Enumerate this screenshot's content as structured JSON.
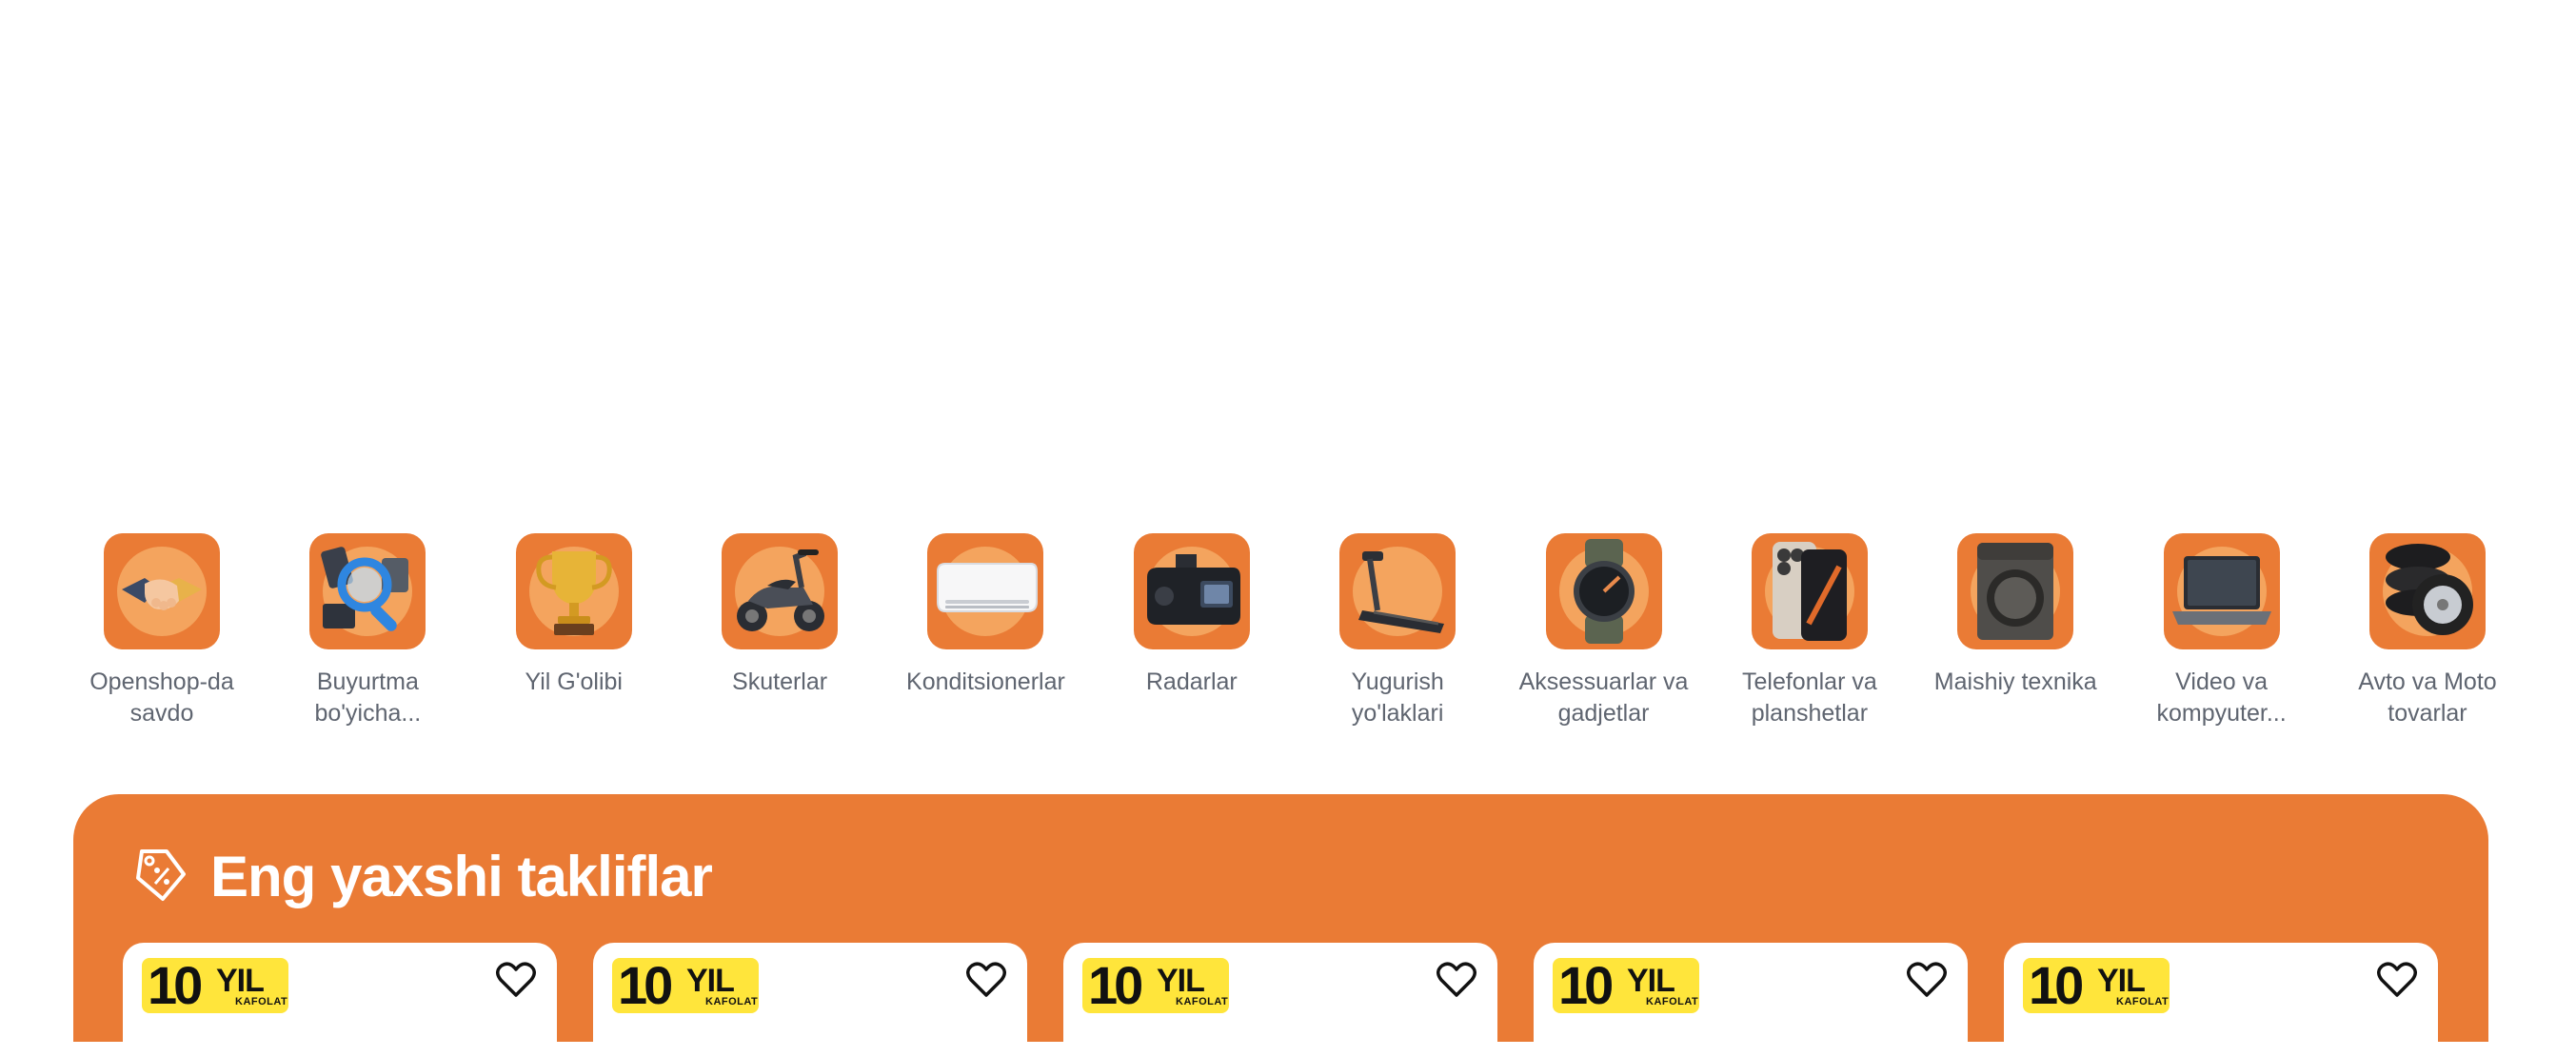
{
  "categories": [
    {
      "label": "Openshop-da savdo",
      "icon": "handshake-icon"
    },
    {
      "label": "Buyurtma bo'yicha...",
      "icon": "magnifier-icon"
    },
    {
      "label": "Yil G'olibi",
      "icon": "trophy-icon"
    },
    {
      "label": "Skuterlar",
      "icon": "scooter-icon"
    },
    {
      "label": "Konditsionerlar",
      "icon": "air-conditioner-icon"
    },
    {
      "label": "Radarlar",
      "icon": "radar-detector-icon"
    },
    {
      "label": "Yugurish yo'laklari",
      "icon": "treadmill-icon"
    },
    {
      "label": "Aksessuarlar va gadjetlar",
      "icon": "smartwatch-icon"
    },
    {
      "label": "Telefonlar va planshetlar",
      "icon": "smartphone-icon"
    },
    {
      "label": "Maishiy texnika",
      "icon": "washing-machine-icon"
    },
    {
      "label": "Video va kompyuter...",
      "icon": "laptop-icon"
    },
    {
      "label": "Avto va Moto tovarlar",
      "icon": "tires-icon"
    }
  ],
  "deals": {
    "title": "Eng yaxshi takliflar",
    "icon": "discount-tag-icon",
    "cards": [
      {
        "badge_num": "10",
        "badge_unit": "YIL",
        "badge_sub": "KAFOLAT"
      },
      {
        "badge_num": "10",
        "badge_unit": "YIL",
        "badge_sub": "KAFOLAT"
      },
      {
        "badge_num": "10",
        "badge_unit": "YIL",
        "badge_sub": "KAFOLAT"
      },
      {
        "badge_num": "10",
        "badge_unit": "YIL",
        "badge_sub": "KAFOLAT"
      },
      {
        "badge_num": "10",
        "badge_unit": "YIL",
        "badge_sub": "KAFOLAT"
      }
    ]
  },
  "colors": {
    "accent": "#ea7b35",
    "accent_light": "#f4a45e",
    "badge": "#ffe53b",
    "label": "#5f6570"
  }
}
